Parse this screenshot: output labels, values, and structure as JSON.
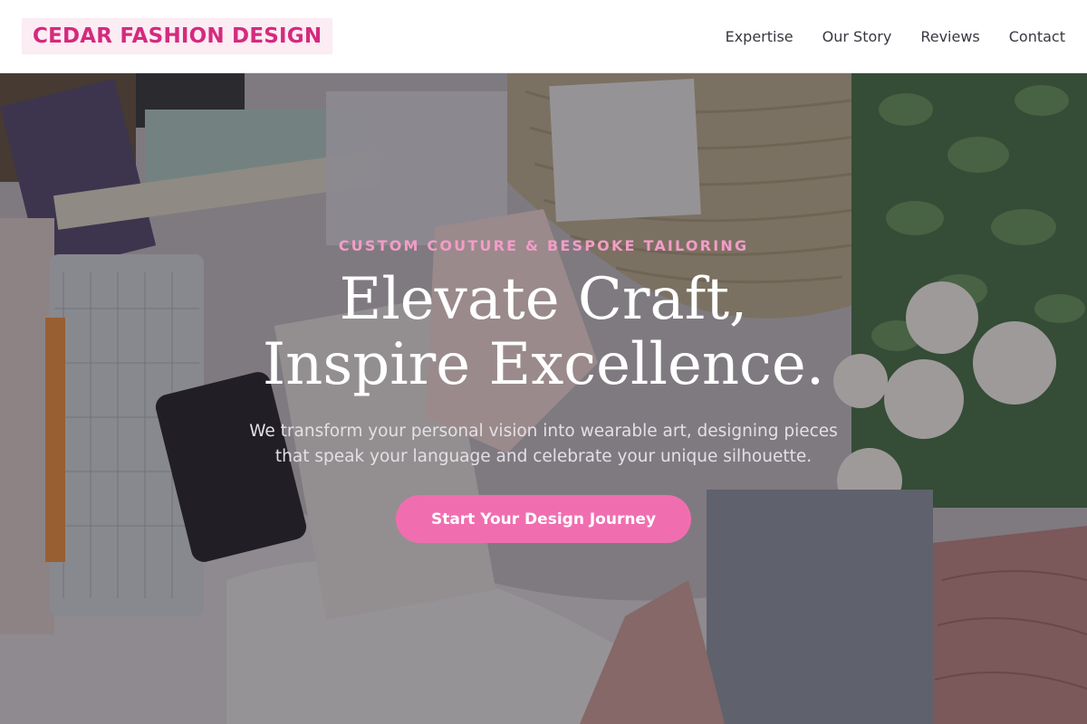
{
  "header": {
    "logo": "CEDAR FASHION DESIGN",
    "nav": [
      {
        "label": "Expertise"
      },
      {
        "label": "Our Story"
      },
      {
        "label": "Reviews"
      },
      {
        "label": "Contact"
      }
    ]
  },
  "hero": {
    "eyebrow": "CUSTOM COUTURE & BESPOKE TAILORING",
    "headline": "Elevate Craft, Inspire Excellence.",
    "subtext": "We transform your personal vision into wearable art, designing pieces that speak your language and celebrate your unique silhouette.",
    "cta_label": "Start Your Design Journey",
    "background_image": "flat-lay-workspace-photo"
  },
  "colors": {
    "brand": "#d42a7e",
    "logo_background": "#fcecf3",
    "accent": "#f06eb0",
    "eyebrow": "#f49cc8"
  }
}
